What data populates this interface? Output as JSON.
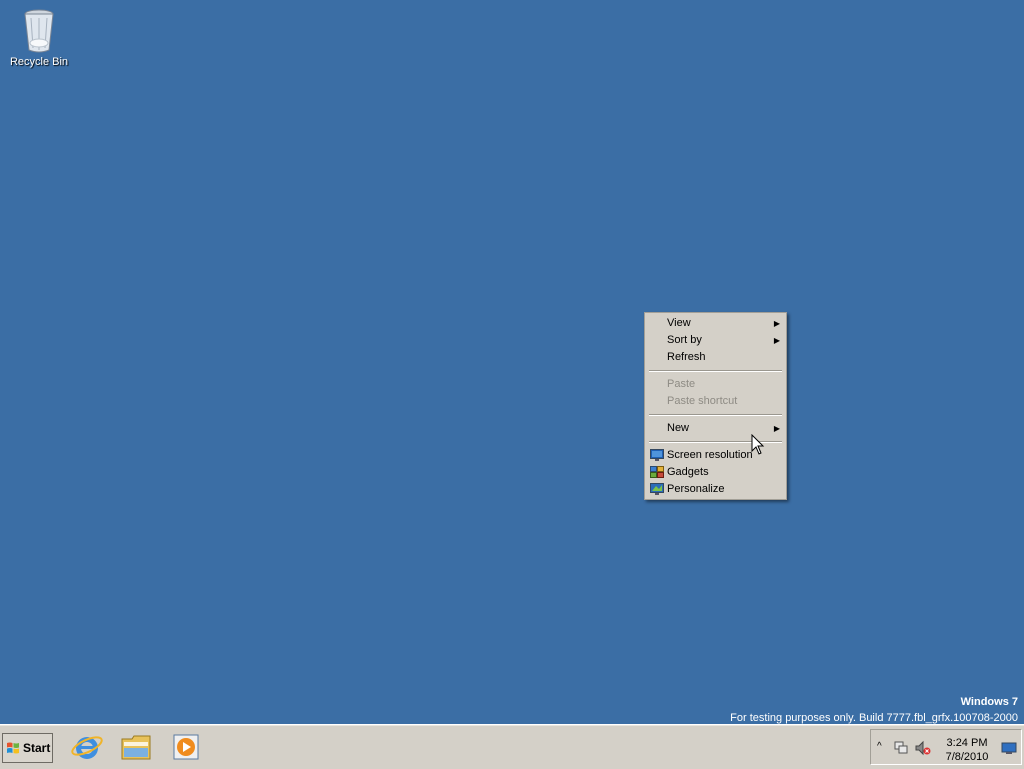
{
  "desktop": {
    "recycle_bin_label": "Recycle Bin"
  },
  "watermark": {
    "title": "Windows 7",
    "build": "For testing purposes only. Build 7777.fbl_grfx.100708-2000"
  },
  "context_menu": {
    "items": [
      {
        "label": "View"
      },
      {
        "label": "Sort by"
      },
      {
        "label": "Refresh"
      },
      {
        "label": "Paste"
      },
      {
        "label": "Paste shortcut"
      },
      {
        "label": "New"
      },
      {
        "label": "Screen resolution",
        "icon": "monitor-icon"
      },
      {
        "label": "Gadgets",
        "icon": "gadgets-icon"
      },
      {
        "label": "Personalize",
        "icon": "personalize-icon"
      }
    ]
  },
  "taskbar": {
    "start_label": "Start",
    "pinned": [
      {
        "icon": "internet-explorer-icon"
      },
      {
        "icon": "windows-explorer-icon"
      },
      {
        "icon": "media-player-icon"
      }
    ],
    "clock": {
      "time": "3:24 PM",
      "date": "7/8/2010"
    }
  },
  "colors": {
    "desktop_bg": "#3b6ea5",
    "menu_bg": "#d4d0c8",
    "taskbar_bg": "#d4d0c8"
  }
}
